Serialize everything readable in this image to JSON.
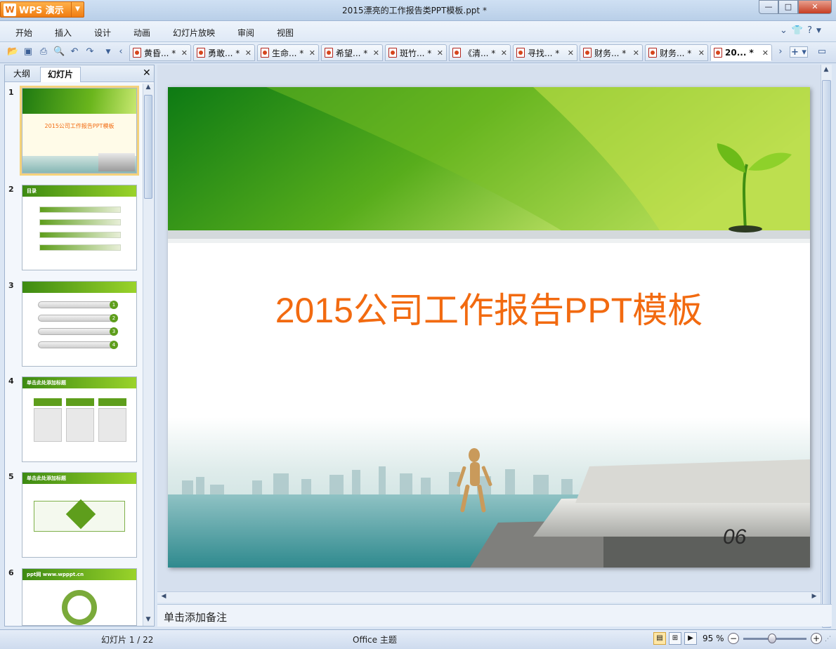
{
  "app": {
    "name": "WPS 演示",
    "title": "2015漂亮的工作报告类PPT模板.ppt *"
  },
  "window_controls": {
    "minimize": "—",
    "maximize": "□",
    "close": "✕"
  },
  "menu": [
    "开始",
    "插入",
    "设计",
    "动画",
    "幻灯片放映",
    "审阅",
    "视图"
  ],
  "tabs": [
    {
      "label": "黄昏... *"
    },
    {
      "label": "勇敢... *"
    },
    {
      "label": "生命... *"
    },
    {
      "label": "希望... *"
    },
    {
      "label": "斑竹... *"
    },
    {
      "label": "《清... *"
    },
    {
      "label": "寻找... *"
    },
    {
      "label": "财务... *"
    },
    {
      "label": "财务... *"
    },
    {
      "label": "20... *",
      "active": true
    }
  ],
  "panel": {
    "tab_outline": "大纲",
    "tab_slides": "幻灯片"
  },
  "thumbnails": [
    {
      "num": "1",
      "title": "2015公司工作报告PPT模板"
    },
    {
      "num": "2",
      "title": "目录"
    },
    {
      "num": "3",
      "title": ""
    },
    {
      "num": "4",
      "title": "单击此处添加标题"
    },
    {
      "num": "5",
      "title": "单击此处添加标题"
    },
    {
      "num": "6",
      "title": "ppt网 www.wpppt.cn"
    }
  ],
  "thumb3_numbers": [
    "1",
    "2",
    "3",
    "4"
  ],
  "slide": {
    "title": "2015公司工作报告PPT模板",
    "book_number": "06"
  },
  "notes": {
    "placeholder": "单击添加备注"
  },
  "status": {
    "slide_position": "幻灯片 1 / 22",
    "theme": "Office 主题",
    "zoom": "95 %",
    "zoom_level": 0.45
  },
  "colors": {
    "accent_green": "#5e9e1c",
    "title_orange": "#f26a10",
    "wps_orange": "#f07d12"
  }
}
